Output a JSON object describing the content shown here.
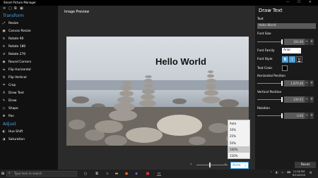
{
  "app": {
    "title": "Smart Picture Manager",
    "window_controls": [
      "—",
      "☐",
      "✕"
    ]
  },
  "sidebar": {
    "top_icons": [
      "≡",
      "▢",
      "⧉",
      "▣"
    ],
    "sections": [
      {
        "title": "Transform",
        "items": [
          {
            "label": "Resize",
            "icon": "resize-icon",
            "glyph": "⤢"
          },
          {
            "label": "Canvas Resize",
            "icon": "canvas-resize-icon",
            "glyph": "▣"
          },
          {
            "label": "Rotate 90",
            "icon": "rotate-icon",
            "glyph": "↻"
          },
          {
            "label": "Rotate 180",
            "icon": "rotate-icon",
            "glyph": "↻"
          },
          {
            "label": "Rotate 270",
            "icon": "rotate-icon",
            "glyph": "↺"
          },
          {
            "label": "Round Corners",
            "icon": "round-corners-icon",
            "glyph": "◉"
          },
          {
            "label": "Flip Horizontal",
            "icon": "flip-horizontal-icon",
            "glyph": "⇋"
          },
          {
            "label": "Flip Vertical",
            "icon": "flip-vertical-icon",
            "glyph": "⇅"
          },
          {
            "label": "Crop",
            "icon": "crop-icon",
            "glyph": "⌗"
          },
          {
            "label": "Draw Text",
            "icon": "draw-text-icon",
            "glyph": "A"
          },
          {
            "label": "Draw",
            "icon": "draw-icon",
            "glyph": "✎"
          },
          {
            "label": "Shape",
            "icon": "shape-icon",
            "glyph": "◇"
          },
          {
            "label": "Pan",
            "icon": "pan-icon",
            "glyph": "✥"
          }
        ]
      },
      {
        "title": "Adjust",
        "items": [
          {
            "label": "Hue Shift",
            "icon": "hue-shift-icon",
            "glyph": "◐"
          },
          {
            "label": "Saturation",
            "icon": "saturation-icon",
            "glyph": "◑"
          }
        ]
      }
    ]
  },
  "main": {
    "preview_label": "Image Preview",
    "overlay_text": "Hello World",
    "zoom": {
      "selected": "Auto",
      "options": [
        "Auto",
        "10%",
        "25%",
        "50%",
        "100%",
        "150%"
      ],
      "highlighted": "100%"
    }
  },
  "panel": {
    "title": "Draw Text",
    "text_label": "Text",
    "text_value": "Hello World",
    "font_size_label": "Font Size",
    "font_size_value": "160.00",
    "font_family_label": "Font Family",
    "font_family_value": "Arial",
    "font_style_label": "Font Style",
    "font_style_buttons": [
      "B",
      "I",
      "U"
    ],
    "text_color_label": "Text Color",
    "text_color": "#000000",
    "horizontal_label": "Horizontal Position",
    "horizontal_value": "1,879.46",
    "vertical_label": "Vertical Position",
    "vertical_value": "339.52",
    "rotation_label": "Rotation",
    "rotation_value": "0.00",
    "reset_label": "Reset"
  },
  "taskbar": {
    "search_placeholder": "Type here to search",
    "time": "11:26 PM",
    "date": "6/14/2020"
  },
  "colors": {
    "accent": "#4aa3df",
    "sidebar_bg": "#111111",
    "panel_bg": "#1a1a1a"
  }
}
